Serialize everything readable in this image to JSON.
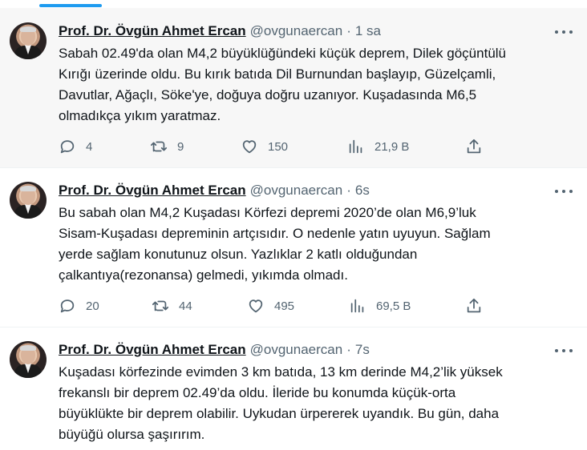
{
  "tweets": [
    {
      "author": "Prof. Dr. Övgün Ahmet Ercan",
      "handle": "@ovgunaercan",
      "dot": "·",
      "time": "1 sa",
      "lines": [
        "Sabah 02.49'da olan M4,2 büyüklüğündeki küçük deprem, Dilek göçüntülü",
        "Kırığı üzerinde oldu. Bu kırık batıda Dil Burnundan başlayıp, Güzelçamli,",
        "Davutlar, Ağaçlı, Söke'ye, doğuya doğru uzanıyor. Kuşadasında  M6,5",
        "olmadıkça yıkım yaratmaz."
      ],
      "replies": "4",
      "retweets": "9",
      "likes": "150",
      "views": "21,9 B"
    },
    {
      "author": "Prof. Dr. Övgün Ahmet Ercan",
      "handle": "@ovgunaercan",
      "dot": "·",
      "time": "6s",
      "lines": [
        "Bu sabah olan M4,2 Kuşadası Körfezi depremi 2020’de olan M6,9’luk",
        "Sisam-Kuşadası depreminin artçısıdır. O nedenle yatın uyuyun. Sağlam",
        "yerde sağlam konutunuz olsun. Yazlıklar 2 katlı olduğundan",
        "çalkantıya(rezonansa) gelmedi, yıkımda olmadı."
      ],
      "replies": "20",
      "retweets": "44",
      "likes": "495",
      "views": "69,5 B"
    },
    {
      "author": "Prof. Dr. Övgün Ahmet Ercan",
      "handle": "@ovgunaercan",
      "dot": "·",
      "time": "7s",
      "lines": [
        "Kuşadası körfezinde evimden 3 km batıda, 13 km derinde M4,2’lik yüksek",
        "frekanslı bir deprem 02.49’da oldu. İleride bu konumda küçük-orta",
        "büyüklükte bir deprem olabilir. Uykudan ürpererek uyandık. Bu gün, daha",
        "büyüğü olursa şaşırırım."
      ]
    }
  ],
  "colors": {
    "accent": "#1d9bf0",
    "muted": "#536471",
    "text": "#0f1419",
    "highlight_bg": "#f7f7f7"
  },
  "icons": [
    "reply-icon",
    "retweet-icon",
    "like-icon",
    "views-icon",
    "share-icon",
    "more-icon"
  ]
}
